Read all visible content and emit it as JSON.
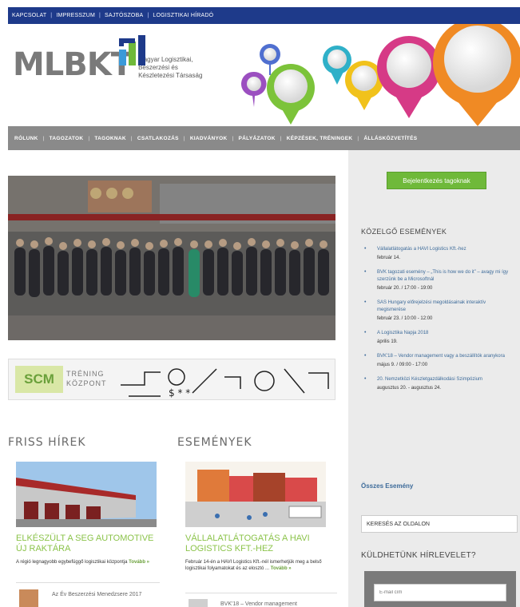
{
  "topbar": {
    "items": [
      "KAPCSOLAT",
      "IMPRESSZUM",
      "SAJTÓSZOBA",
      "LOGISZTIKAI HÍRADÓ"
    ],
    "separator": "|"
  },
  "logo": {
    "letters": "MLBKT",
    "line1": "Magyar Logisztikai,",
    "line2": "Beszerzési és",
    "line3": "Készletezési Társaság"
  },
  "mainnav": {
    "items": [
      "RÓLUNK",
      "TAGOZATOK",
      "TAGOKNAK",
      "CSATLAKOZÁS",
      "KIADVÁNYOK",
      "PÁLYÁZATOK",
      "KÉPZÉSEK, TRÉNINGEK",
      "ÁLLÁSKÖZVETÍTÉS"
    ],
    "separator": "|"
  },
  "scm_banner": {
    "badge": "SCM",
    "sub1": "TRÉNING",
    "sub2": "KÖZPONT"
  },
  "news": {
    "heading": "FRISS HÍREK",
    "title": "ELKÉSZÜLT A SEG AUTOMOTIVE ÚJ RAKTÁRA",
    "text": "A régió legnagyobb egybefüggő logisztikai központja",
    "more": "Tovább »",
    "small_item": "Az Év Beszerzési Menedzsere 2017"
  },
  "events_col": {
    "heading": "ESEMÉNYEK",
    "title": "VÁLLALATLÁTOGATÁS A HAVI LOGISTICS KFT.-HEZ",
    "text": "Február 14-én a HAVI Logistics Kft.-nél ismerhetjük meg a belső logisztikai folyamatokat és az elosztó ...",
    "more": "Tovább »",
    "small_item": "BVK'18 – Vendor management"
  },
  "sidebar": {
    "login_button": "Bejelentkezés tagoknak",
    "upcoming_title": "KÖZELGŐ ESEMÉNYEK",
    "events": [
      {
        "title": "Vállalatlátogatás a HAVI Logistics Kft.-hez",
        "date": "február 14."
      },
      {
        "title": "BVK tagozati esemény – „This is how we do it” – avagy mi így szerzünk be a Microsoftnál",
        "date": "február 20. / 17:00 - 19:00"
      },
      {
        "title": "SAS Hungary előrejelzési megoldásainak interaktív megismerése",
        "date": "február 23. / 10:00 - 12:00"
      },
      {
        "title": "A Logisztika Napja 2018",
        "date": "április 19."
      },
      {
        "title": "BVK'18 – Vendor management vagy a beszállítók aranykora",
        "date": "május 9. / 09:00 - 17:00"
      },
      {
        "title": "20. Nemzetközi Készletgazdálkodási Szimpózium",
        "date": "augusztus 20. - augusztus 24."
      }
    ],
    "all_events": "Összes Esemény",
    "search_label": "KERESÉS AZ OLDALON",
    "newsletter_title": "KÜLDHETÜNK HÍRLEVELET?",
    "email_placeholder": "E-mail cím"
  },
  "colors": {
    "topbar": "#1e3a8a",
    "nav": "#8a8a8a",
    "accent_green": "#8bc34a",
    "link_blue": "#3d6b9a",
    "sidebar_bg": "#ebebeb"
  }
}
